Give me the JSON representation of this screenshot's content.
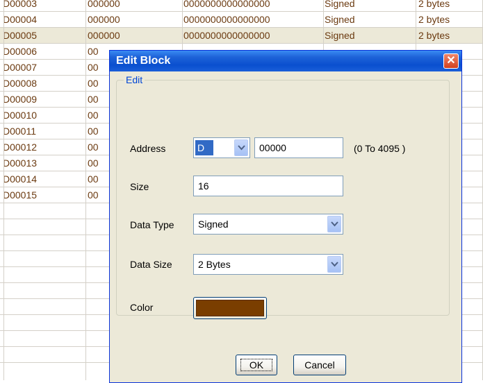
{
  "grid": {
    "rows": [
      {
        "name": "D00003",
        "value": "000000",
        "bits": "0000000000000000",
        "type": "Signed",
        "size": "2 bytes"
      },
      {
        "name": "D00004",
        "value": "000000",
        "bits": "0000000000000000",
        "type": "Signed",
        "size": "2 bytes"
      },
      {
        "name": "D00005",
        "value": "000000",
        "bits": "0000000000000000",
        "type": "Signed",
        "size": "2 bytes"
      },
      {
        "name": "D00006",
        "value": "00",
        "bits": "",
        "type": "",
        "size": ""
      },
      {
        "name": "D00007",
        "value": "00",
        "bits": "",
        "type": "",
        "size": ""
      },
      {
        "name": "D00008",
        "value": "00",
        "bits": "",
        "type": "",
        "size": ""
      },
      {
        "name": "D00009",
        "value": "00",
        "bits": "",
        "type": "",
        "size": ""
      },
      {
        "name": "D00010",
        "value": "00",
        "bits": "",
        "type": "",
        "size": ""
      },
      {
        "name": "D00011",
        "value": "00",
        "bits": "",
        "type": "",
        "size": ""
      },
      {
        "name": "D00012",
        "value": "00",
        "bits": "",
        "type": "",
        "size": ""
      },
      {
        "name": "D00013",
        "value": "00",
        "bits": "",
        "type": "",
        "size": ""
      },
      {
        "name": "D00014",
        "value": "00",
        "bits": "",
        "type": "",
        "size": ""
      },
      {
        "name": "D00015",
        "value": "00",
        "bits": "",
        "type": "",
        "size": ""
      }
    ],
    "empty_row_count": 10,
    "selected_row": 2,
    "text_color": "#6b3a10"
  },
  "dialog": {
    "title": "Edit Block",
    "close_label": "✕",
    "group_label": "Edit",
    "address": {
      "label": "Address",
      "prefix": "D",
      "value": "00000",
      "range": "(0 To 4095 )"
    },
    "size": {
      "label": "Size",
      "value": "16"
    },
    "data_type": {
      "label": "Data Type",
      "value": "Signed"
    },
    "data_size": {
      "label": "Data Size",
      "value": "2 Bytes"
    },
    "color": {
      "label": "Color",
      "value": "#7a3e00"
    },
    "ok_label": "OK",
    "cancel_label": "Cancel"
  }
}
